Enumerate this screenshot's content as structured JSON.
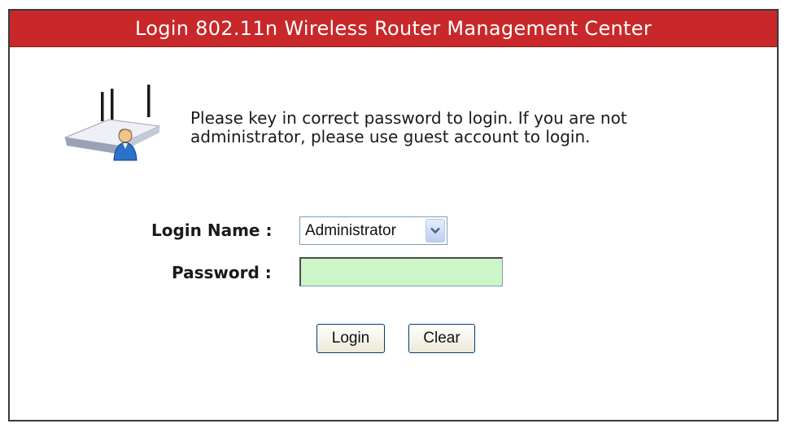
{
  "header": {
    "title": "Login 802.11n Wireless Router Management Center"
  },
  "intro": {
    "icon": "router-with-user-icon",
    "line1": "Please key in correct password to login. If you are not",
    "line2": "administrator, please use guest account to login."
  },
  "form": {
    "login_name_label": "Login Name :",
    "login_name_value": "Administrator",
    "login_name_options": [
      "Administrator"
    ],
    "password_label": "Password :",
    "password_value": "",
    "password_bg": "#ccf5c8"
  },
  "buttons": {
    "login_label": "Login",
    "clear_label": "Clear"
  },
  "colors": {
    "title_bar": "#c8282a",
    "border": "#3a3a3a"
  }
}
